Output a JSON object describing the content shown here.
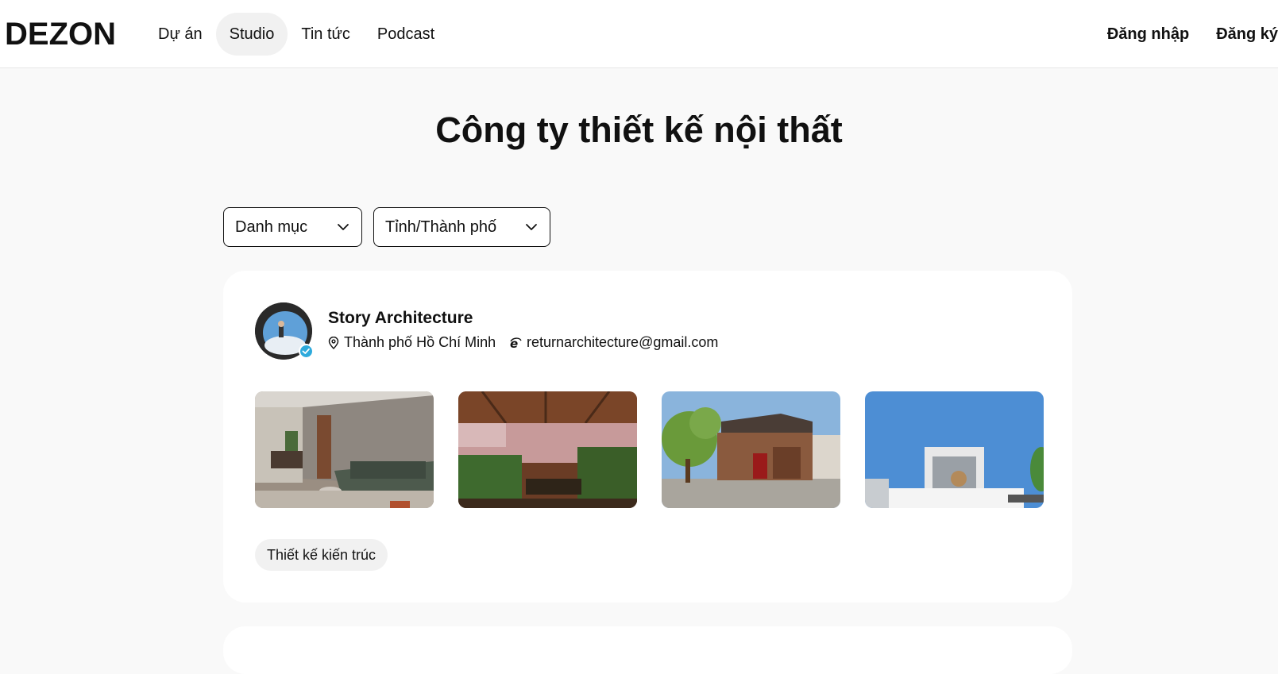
{
  "header": {
    "logo": "DEZON",
    "nav": [
      "Dự án",
      "Studio",
      "Tin tức",
      "Podcast"
    ],
    "active_nav": "Studio",
    "login": "Đăng nhập",
    "register": "Đăng ký"
  },
  "page": {
    "title": "Công ty thiết kế nội thất"
  },
  "filters": {
    "category": "Danh mục",
    "city": "Tỉnh/Thành phố"
  },
  "studio": {
    "name": "Story Architecture",
    "location": "Thành phố Hồ Chí Minh",
    "email": "returnarchitecture@gmail.com",
    "tag": "Thiết kế kiến trúc",
    "verified": true
  },
  "icons": {
    "location": "map-pin-icon",
    "email": "email-icon",
    "dropdown": "chevron-down-icon",
    "verified": "verified-check-icon"
  },
  "colors": {
    "page_bg": "#f9f9f9",
    "card_bg": "#ffffff",
    "text": "#111111",
    "verified": "#2eaadc",
    "chip_bg": "#f1f1f1"
  }
}
